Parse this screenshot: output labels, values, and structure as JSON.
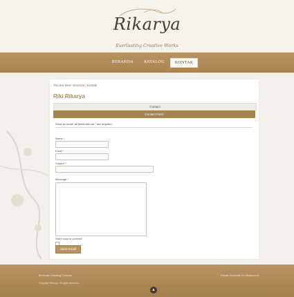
{
  "brand": {
    "logo_text": "Rikarya",
    "tagline": "Everlasting Creative Works"
  },
  "nav": {
    "items": [
      "BERANDA",
      "KATALOG",
      "KONTAK"
    ],
    "active_index": 2
  },
  "breadcrumb": {
    "prefix": "You are here:",
    "home": "Beranda",
    "separator": "/",
    "current": "Kontak"
  },
  "page": {
    "title": "Riki Rikarya",
    "tab_contact": "Contact",
    "tab_form": "Contact Form",
    "required_note": "Send an email. All fields with an * are required.",
    "fields": {
      "name": "Name *",
      "email": "Email *",
      "subject": "Subject *",
      "message": "Message *"
    },
    "send_copy": "Send copy to yourself",
    "send_button": "Send Email"
  },
  "footer": {
    "links": "Beranda | Katalog | Kontak",
    "copyright": "Copyright Rikarya. All rights reserved.",
    "right": "Desain template by rikarya.com"
  },
  "icons": {
    "footer_icon": "back-to-top-icon"
  },
  "colors": {
    "accent": "#b08a5a",
    "navbar": "#b38b58",
    "background": "#f4f1ec"
  }
}
